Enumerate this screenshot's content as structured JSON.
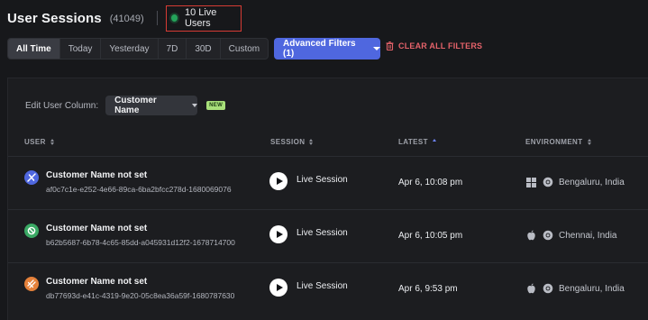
{
  "header": {
    "title": "User Sessions",
    "count": "(41049)",
    "live_users": "10 Live Users"
  },
  "time_range": {
    "options": [
      "All Time",
      "Today",
      "Yesterday",
      "7D",
      "30D",
      "Custom"
    ],
    "selected": "All Time"
  },
  "filters": {
    "advanced_label": "Advanced Filters (1)",
    "clear_label": "CLEAR ALL FILTERS"
  },
  "panel": {
    "edit_column_label": "Edit User Column:",
    "column_select_value": "Customer Name",
    "new_badge": "NEW"
  },
  "table": {
    "columns": {
      "user": "USER",
      "session": "SESSION",
      "latest": "LATEST",
      "environment": "ENVIRONMENT"
    },
    "rows": [
      {
        "name": "Customer Name not set",
        "id": "af0c7c1e-e252-4e66-89ca-6ba2bfcc278d-1680069076",
        "session": "Live Session",
        "latest": "Apr 6, 10:08 pm",
        "os_icon": "windows-icon",
        "browser_icon": "chrome-icon",
        "location": "Bengaluru, India",
        "avatar_color": "#4f67df"
      },
      {
        "name": "Customer Name not set",
        "id": "b62b5687-6b78-4c65-85dd-a045931d12f2-1678714700",
        "session": "Live Session",
        "latest": "Apr 6, 10:05 pm",
        "os_icon": "apple-icon",
        "browser_icon": "chrome-icon",
        "location": "Chennai, India",
        "avatar_color": "#3aa864"
      },
      {
        "name": "Customer Name not set",
        "id": "db77693d-e41c-4319-9e20-05c8ea36a59f-1680787630",
        "session": "Live Session",
        "latest": "Apr 6, 9:53 pm",
        "os_icon": "apple-icon",
        "browser_icon": "chrome-icon",
        "location": "Bengaluru, India",
        "avatar_color": "#e5813a"
      }
    ]
  }
}
